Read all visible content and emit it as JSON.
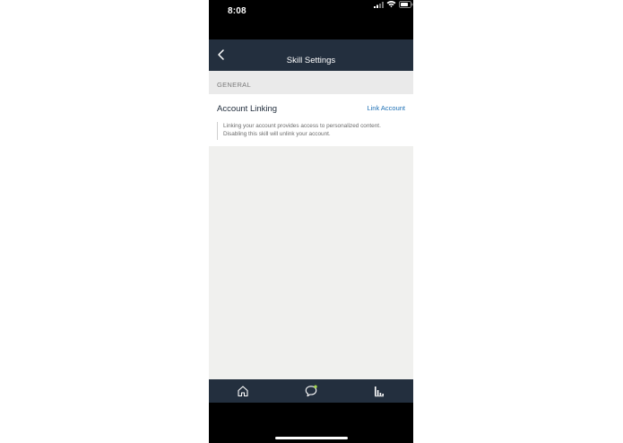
{
  "status_bar": {
    "time": "8:08",
    "icons": [
      "signal-icon",
      "wifi-icon",
      "battery-icon"
    ]
  },
  "nav": {
    "title": "Skill Settings",
    "back_icon": "chevron-left-icon"
  },
  "section": {
    "label": "GENERAL"
  },
  "account_linking": {
    "title": "Account Linking",
    "action_label": "Link Account",
    "description": "Linking your account provides access to personalized content.\nDisabling this skill will unlink your account."
  },
  "tab_bar": {
    "items": [
      {
        "icon": "home-icon"
      },
      {
        "icon": "chat-icon"
      },
      {
        "icon": "devices-icon"
      }
    ]
  },
  "colors": {
    "nav_background": "#232f3e",
    "link": "#1c6fb5",
    "content_background": "#f0f0ee",
    "notification_dot": "#a6d84e"
  }
}
